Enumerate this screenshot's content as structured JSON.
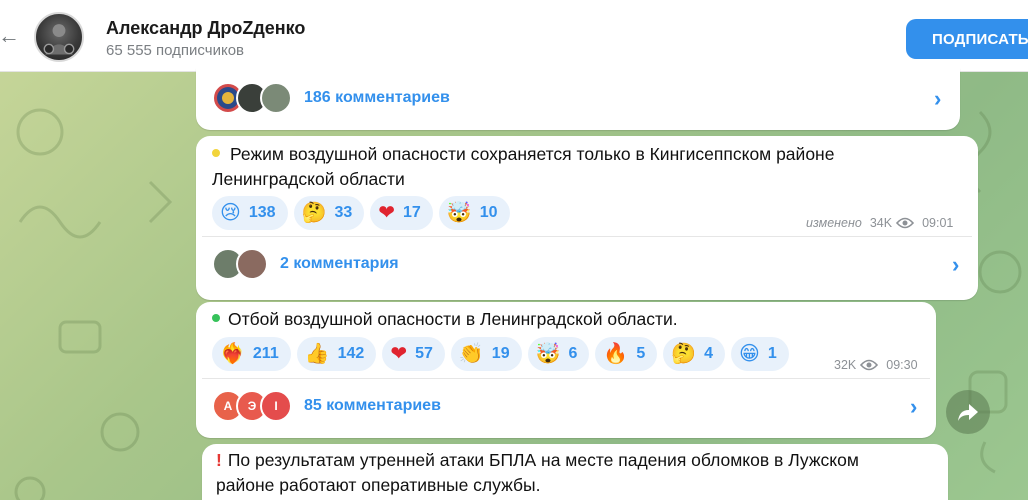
{
  "header": {
    "back_icon": "arrow-left-icon",
    "channel_name": "Александр ДроZденко",
    "subscribers": "65 555 подписчиков",
    "subscribe_button": "ПОДПИСАТЬ"
  },
  "posts": [
    {
      "comments_label": "186 комментариев"
    },
    {
      "text_line1": "Режим воздушной опасности сохраняется только в Кингисеппском районе",
      "text_line2": "Ленинградской области",
      "reactions": [
        {
          "emoji": "😢",
          "count": "138"
        },
        {
          "emoji": "🤔",
          "count": "33"
        },
        {
          "emoji": "❤",
          "count": "17"
        },
        {
          "emoji": "🤯",
          "count": "10"
        }
      ],
      "edited": "изменено",
      "views": "34K",
      "time": "09:01",
      "comments_label": "2 комментария"
    },
    {
      "text_line1": "Отбой воздушной опасности в Ленинградской области.",
      "reactions": [
        {
          "emoji": "❤‍🔥",
          "count": "211"
        },
        {
          "emoji": "👍",
          "count": "142"
        },
        {
          "emoji": "❤",
          "count": "57"
        },
        {
          "emoji": "👏",
          "count": "19"
        },
        {
          "emoji": "🤯",
          "count": "6"
        },
        {
          "emoji": "🔥",
          "count": "5"
        },
        {
          "emoji": "🤔",
          "count": "4"
        },
        {
          "emoji": "😁",
          "count": "1"
        }
      ],
      "views": "32K",
      "time": "09:30",
      "comment_avatars": [
        "А",
        "Э",
        "I"
      ],
      "comments_label": "85 комментариев"
    },
    {
      "text_line1": "По результатам утренней атаки БПЛА на месте падения обломков в Лужском",
      "text_line2": "районе работают оперативные службы."
    }
  ],
  "icons": {
    "views": "eye-icon",
    "chevron": "chevron-right-icon",
    "share": "share-icon",
    "warning": "exclamation-icon"
  },
  "colors": {
    "accent": "#3390ec",
    "reaction_bg": "#e8f1fb",
    "subscribe_bg": "#3390ec"
  }
}
